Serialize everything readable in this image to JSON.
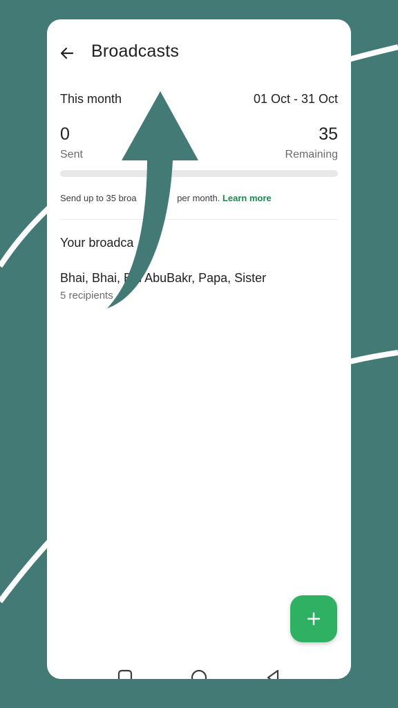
{
  "theme": {
    "background": "#447a76",
    "accent": "#1fa855",
    "fab": "#2fb164",
    "link": "#1b8a4e"
  },
  "header": {
    "back_icon": "arrow-left-icon",
    "title": "Broadcasts"
  },
  "usage": {
    "period_label": "This month",
    "period_range": "01 Oct - 31 Oct",
    "sent_count": "0",
    "sent_label": "Sent",
    "remaining_count": "35",
    "remaining_label": "Remaining",
    "progress_fraction": 0,
    "limit_text_before": "Send up to 35 broa",
    "limit_text_after": " per month. ",
    "learn_more": "Learn more"
  },
  "broadcasts": {
    "section_title": "Your broadca",
    "items": [
      {
        "title_a": "Bhai, Bhai, B",
        "title_b": "i AbuBakr, Papa, Sister",
        "subtitle": "5 recipients"
      }
    ]
  },
  "fab": {
    "icon": "plus-icon"
  },
  "nav": {
    "recents_icon": "square-icon",
    "home_icon": "circle-icon",
    "back_icon": "triangle-back-icon"
  }
}
